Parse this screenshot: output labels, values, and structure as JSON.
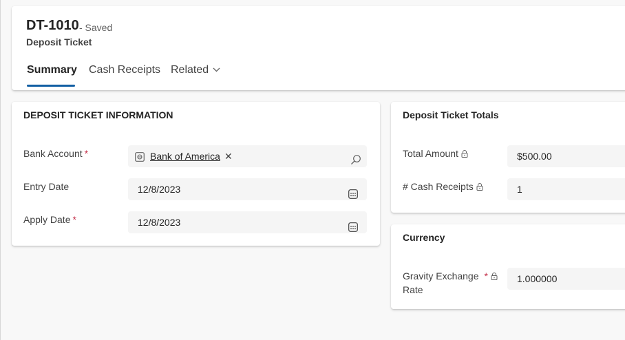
{
  "header": {
    "record_id": "DT-1010",
    "status": "- Saved",
    "entity_name": "Deposit Ticket",
    "tabs": [
      {
        "label": "Summary"
      },
      {
        "label": "Cash Receipts"
      },
      {
        "label": "Related"
      }
    ]
  },
  "info_section": {
    "title": "DEPOSIT TICKET INFORMATION",
    "bank_account": {
      "label": "Bank Account",
      "required": "*",
      "value": "Bank of America"
    },
    "entry_date": {
      "label": "Entry Date",
      "value": "12/8/2023"
    },
    "apply_date": {
      "label": "Apply Date",
      "required": "*",
      "value": "12/8/2023"
    }
  },
  "totals_section": {
    "title": "Deposit Ticket Totals",
    "total_amount": {
      "label": "Total Amount",
      "value": "$500.00"
    },
    "cash_receipts": {
      "label": "# Cash Receipts",
      "value": "1"
    }
  },
  "currency_section": {
    "title": "Currency",
    "exchange_rate": {
      "label_line1": "Gravity Exchange",
      "label_line2": "Rate",
      "required": "*",
      "value": "1.000000"
    }
  },
  "colors": {
    "accent": "#115ea3",
    "required": "#c4314b",
    "field_bg": "#f5f5f5",
    "page_bg": "#f8f8f8"
  }
}
